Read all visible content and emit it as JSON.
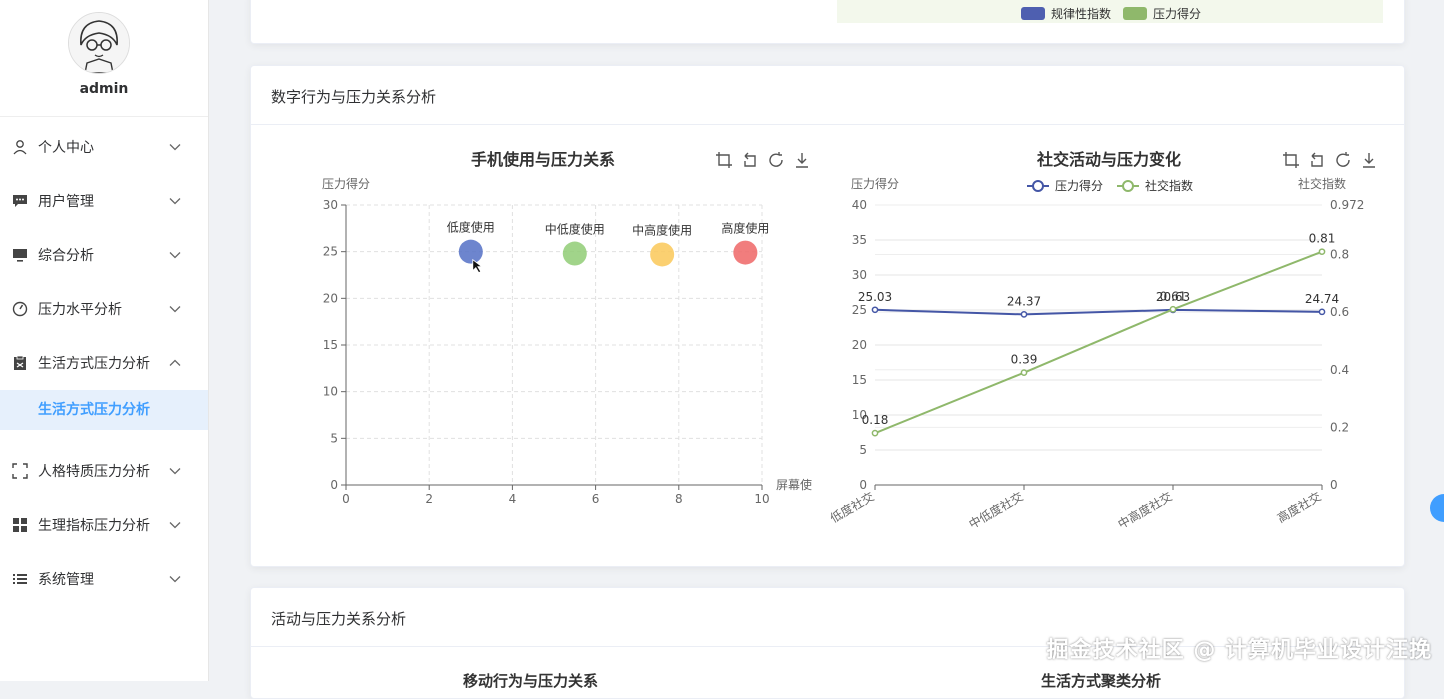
{
  "user": {
    "name": "admin"
  },
  "menu": [
    {
      "label": "个人中心",
      "icon": "user-icon",
      "expanded": false
    },
    {
      "label": "用户管理",
      "icon": "chat-icon",
      "expanded": false
    },
    {
      "label": "综合分析",
      "icon": "monitor-icon",
      "expanded": false
    },
    {
      "label": "压力水平分析",
      "icon": "gauge-icon",
      "expanded": false
    },
    {
      "label": "生活方式压力分析",
      "icon": "clipboard-icon",
      "expanded": true,
      "children": [
        {
          "label": "生活方式压力分析",
          "active": true
        }
      ]
    },
    {
      "label": "人格特质压力分析",
      "icon": "frame-icon",
      "expanded": false
    },
    {
      "label": "生理指标压力分析",
      "icon": "grid-icon",
      "expanded": false
    },
    {
      "label": "系统管理",
      "icon": "list-icon",
      "expanded": false
    }
  ],
  "top_card": {
    "legend": [
      "规律性指数",
      "压力得分"
    ],
    "legend_colors": [
      "#4e5fb0",
      "#8fb86b"
    ]
  },
  "main_card": {
    "title": "数字行为与压力关系分析"
  },
  "bottom_card": {
    "title": "活动与压力关系分析",
    "chart_titles": [
      "移动行为与压力关系",
      "生活方式聚类分析"
    ]
  },
  "chart_data": [
    {
      "type": "scatter",
      "title": "手机使用与压力关系",
      "ylabel": "压力得分",
      "xlabel": "屏幕使",
      "xlim": [
        0,
        10
      ],
      "ylim": [
        0,
        30
      ],
      "xticks": [
        0,
        2,
        4,
        6,
        8,
        10
      ],
      "yticks": [
        0,
        5,
        10,
        15,
        20,
        25,
        30
      ],
      "points": [
        {
          "label": "低度使用",
          "x": 3.0,
          "y": 25.0,
          "color": "#5470c6"
        },
        {
          "label": "中低度使用",
          "x": 5.5,
          "y": 24.8,
          "color": "#91cc75"
        },
        {
          "label": "中高度使用",
          "x": 7.6,
          "y": 24.7,
          "color": "#fac858"
        },
        {
          "label": "高度使用",
          "x": 9.6,
          "y": 24.9,
          "color": "#ee6666"
        }
      ],
      "toolbox": [
        "crop-icon",
        "undo-icon",
        "refresh-icon",
        "download-icon"
      ]
    },
    {
      "type": "line",
      "title": "社交活动与压力变化",
      "categories": [
        "低度社交",
        "中低度社交",
        "中高度社交",
        "高度社交"
      ],
      "ylabel": "压力得分",
      "ylabel_right": "社交指数",
      "ylim": [
        0,
        40
      ],
      "ylim_right": [
        0,
        0.972
      ],
      "yticks": [
        0,
        5,
        10,
        15,
        20,
        25,
        30,
        35,
        40
      ],
      "yticks_right": [
        0,
        0.2,
        0.4,
        0.6,
        0.8,
        0.972
      ],
      "series": [
        {
          "name": "压力得分",
          "axis": "left",
          "color": "#4456a6",
          "values": [
            25.03,
            24.37,
            25.01,
            24.74
          ],
          "labels": [
            "25.03",
            "24.37",
            "20.63",
            "24.74"
          ]
        },
        {
          "name": "社交指数",
          "axis": "right",
          "color": "#8fb86b",
          "values": [
            0.18,
            0.39,
            0.61,
            0.81
          ],
          "labels": [
            "0.18",
            "0.39",
            "0.61",
            "0.81"
          ]
        }
      ],
      "toolbox": [
        "crop-icon",
        "undo-icon",
        "refresh-icon",
        "download-icon"
      ]
    }
  ],
  "watermark": "掘金技术社区 @ 计算机毕业设计汪挽"
}
